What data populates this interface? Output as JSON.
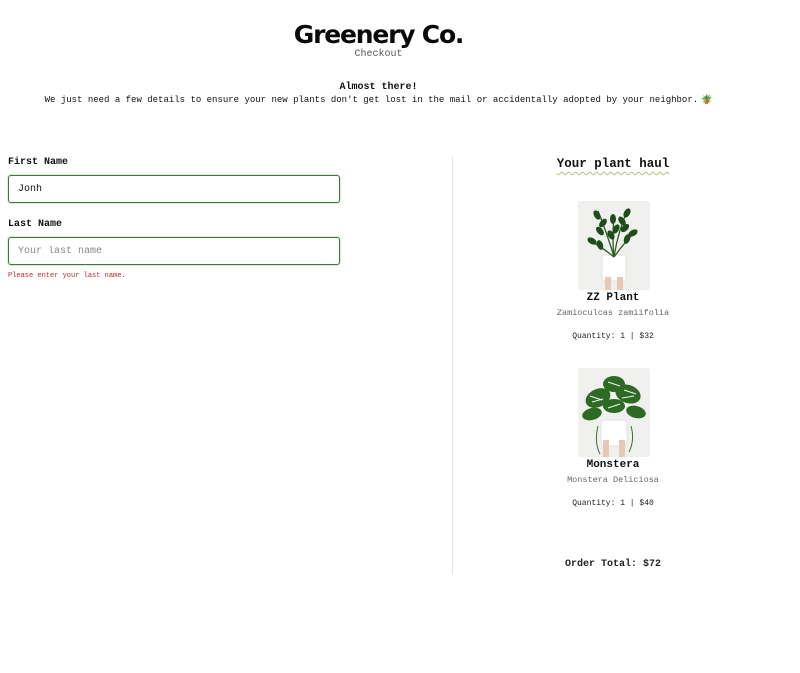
{
  "header": {
    "brand": "Greenery Co.",
    "subtitle": "Checkout"
  },
  "intro": {
    "title": "Almost there!",
    "text": "We just need a few details to ensure your new plants don't get lost in the mail or accidentally adopted by your neighbor."
  },
  "form": {
    "first_name_label": "First Name",
    "first_name_value": "Jonh",
    "last_name_label": "Last Name",
    "last_name_value": "",
    "last_name_placeholder": "Your last name",
    "last_name_error": "Please enter your last name."
  },
  "cart": {
    "title": "Your plant haul",
    "items": [
      {
        "name": "ZZ Plant",
        "scientific": "Zamioculcas zamiifolia",
        "quantity_line": "Quantity: 1 | $32"
      },
      {
        "name": "Monstera",
        "scientific": "Monstera Deliciosa",
        "quantity_line": "Quantity: 1 | $40"
      }
    ],
    "total": "Order Total: $72"
  },
  "icons": {
    "intro_icon": "potted-plant-icon"
  },
  "colors": {
    "field_border": "#3c7a3c",
    "error": "#c62828",
    "underline": "#b5c27a"
  }
}
